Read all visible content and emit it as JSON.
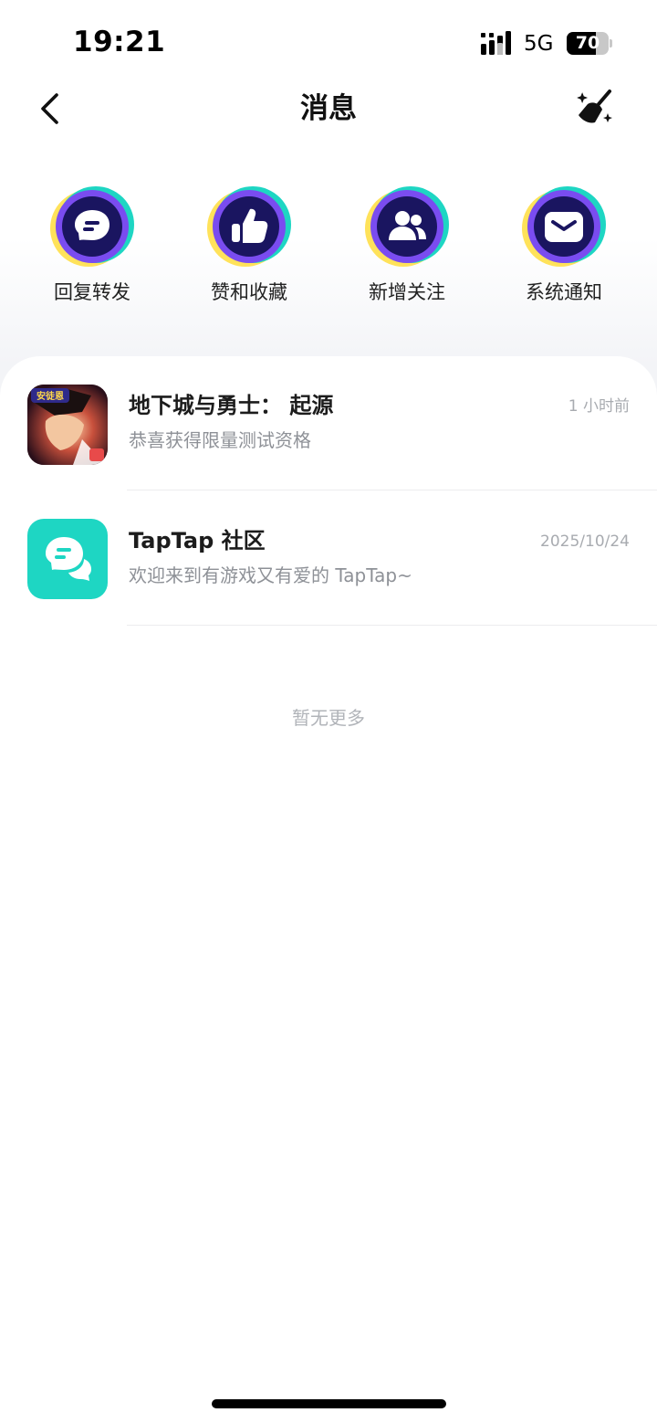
{
  "status_bar": {
    "time": "19:21",
    "network": "5G",
    "battery_level": "70",
    "battery_fraction": 0.7
  },
  "nav": {
    "back_icon": "chevron-left-icon",
    "title": "消息",
    "clean_icon": "broom-sparkle-icon"
  },
  "categories": [
    {
      "label": "回复转发",
      "icon": "chat-bubble-icon"
    },
    {
      "label": "赞和收藏",
      "icon": "thumbs-up-icon"
    },
    {
      "label": "新增关注",
      "icon": "users-icon"
    },
    {
      "label": "系统通知",
      "icon": "envelope-icon"
    }
  ],
  "messages": [
    {
      "title": "地下城与勇士： 起源",
      "subtitle": "恭喜获得限量测试资格",
      "time": "1 小时前",
      "avatar": "game-dnf-origin-icon",
      "badge_text": "安徒恩"
    },
    {
      "title": "TapTap 社区",
      "subtitle": "欢迎来到有游戏又有爱的 TapTap~",
      "time": "2025/10/24",
      "avatar": "taptap-chat-icon"
    }
  ],
  "footer": {
    "no_more": "暂无更多"
  },
  "colors": {
    "accent_teal": "#1ed6c3",
    "icon_navy": "#1a1560",
    "icon_purple": "#7a4cf0",
    "icon_yellow": "#ffe25a"
  }
}
